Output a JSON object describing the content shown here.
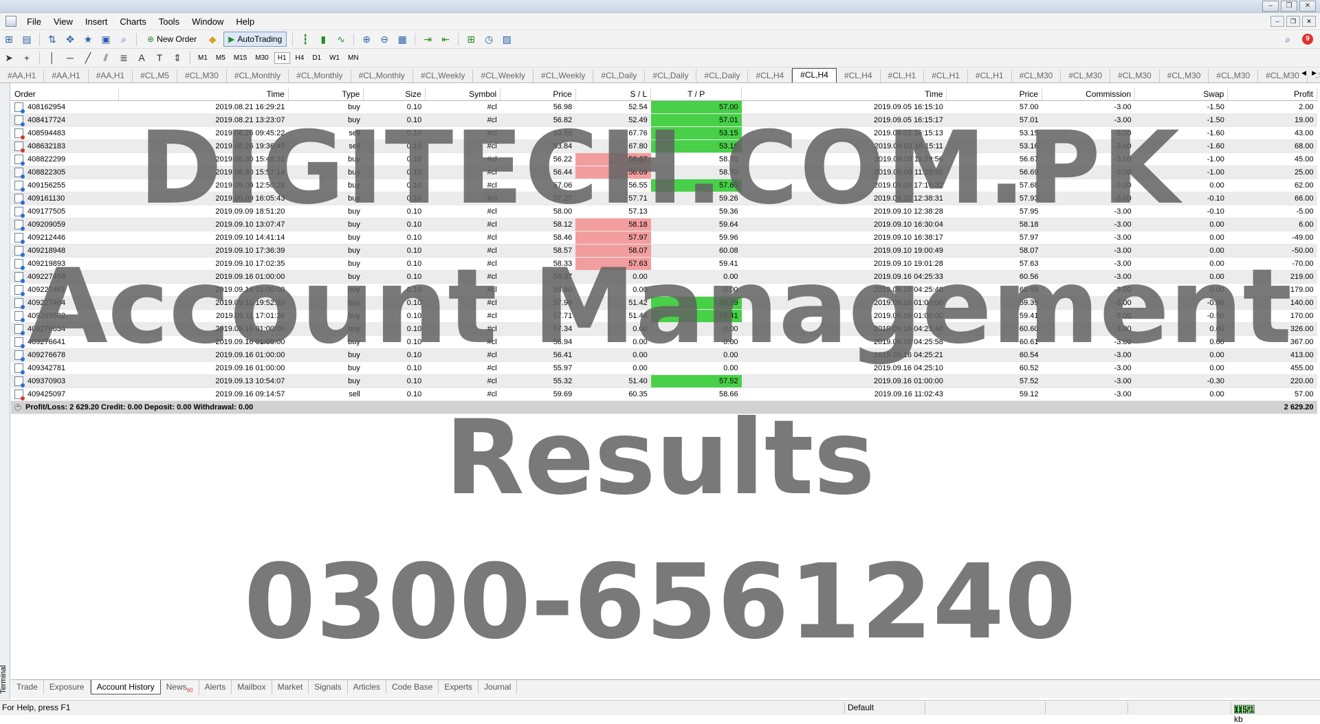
{
  "menu": {
    "items": [
      "File",
      "View",
      "Insert",
      "Charts",
      "Tools",
      "Window",
      "Help"
    ]
  },
  "toolbar": {
    "new_order": "New Order",
    "autotrading": "AutoTrading",
    "timeframes": [
      "M1",
      "M5",
      "M15",
      "M30",
      "H1",
      "H4",
      "D1",
      "W1",
      "MN"
    ],
    "active_timeframe": "H1",
    "notification_count": "9"
  },
  "chart_tabs": [
    "#AA,H1",
    "#AA,H1",
    "#AA,H1",
    "#CL,M5",
    "#CL,M30",
    "#CL,Monthly",
    "#CL,Monthly",
    "#CL,Monthly",
    "#CL,Weekly",
    "#CL,Weekly",
    "#CL,Weekly",
    "#CL,Daily",
    "#CL,Daily",
    "#CL,Daily",
    "#CL,H4",
    "#CL,H4",
    "#CL,H4",
    "#CL,H1",
    "#CL,H1",
    "#CL,H1",
    "#CL,M30",
    "#CL,M30",
    "#CL,M30",
    "#CL,M30",
    "#CL,M30",
    "#CL,M30",
    "#CL,M"
  ],
  "active_chart_tab": 15,
  "columns": [
    "Order",
    "Time",
    "Type",
    "Size",
    "Symbol",
    "Price",
    "S / L",
    "T / P",
    "Time",
    "Price",
    "Commission",
    "Swap",
    "Profit"
  ],
  "rows": [
    {
      "order": "408162954",
      "open_time": "2019.08.21 16:29:21",
      "type": "buy",
      "size": "0.10",
      "symbol": "#cl",
      "price": "56.98",
      "sl": "52.54",
      "tp": "57.00",
      "close_time": "2019.09.05 16:15:10",
      "close_price": "57.00",
      "commission": "-3.00",
      "swap": "-1.50",
      "profit": "2.00",
      "hit": "tp"
    },
    {
      "order": "408417724",
      "open_time": "2019.08.21 13:23:07",
      "type": "buy",
      "size": "0.10",
      "symbol": "#cl",
      "price": "56.82",
      "sl": "52.49",
      "tp": "57.01",
      "close_time": "2019.09.05 16:15:17",
      "close_price": "57.01",
      "commission": "-3.00",
      "swap": "-1.50",
      "profit": "19.00",
      "hit": "tp"
    },
    {
      "order": "408594483",
      "open_time": "2019.08.26 09:45:22",
      "type": "sell",
      "size": "0.10",
      "symbol": "#cl",
      "price": "53.58",
      "sl": "67.76",
      "tp": "53.15",
      "close_time": "2019.09.03 16:15:13",
      "close_price": "53.15",
      "commission": "-3.00",
      "swap": "-1.60",
      "profit": "43.00",
      "hit": "tp"
    },
    {
      "order": "408632183",
      "open_time": "2019.08.26 19:36:45",
      "type": "sell",
      "size": "0.10",
      "symbol": "#cl",
      "price": "53.84",
      "sl": "67.80",
      "tp": "53.16",
      "close_time": "2019.09.03 16:15:11",
      "close_price": "53.16",
      "commission": "-3.00",
      "swap": "-1.60",
      "profit": "68.00",
      "hit": "tp"
    },
    {
      "order": "408822299",
      "open_time": "2019.08.30 15:48:32",
      "type": "buy",
      "size": "0.10",
      "symbol": "#cl",
      "price": "56.22",
      "sl": "56.67",
      "tp": "58.70",
      "close_time": "2019.09.09 11:29:56",
      "close_price": "56.67",
      "commission": "-3.00",
      "swap": "-1.00",
      "profit": "45.00",
      "hit": "sl"
    },
    {
      "order": "408822305",
      "open_time": "2019.08.30 15:57:14",
      "type": "buy",
      "size": "0.10",
      "symbol": "#cl",
      "price": "56.44",
      "sl": "56.69",
      "tp": "58.70",
      "close_time": "2019.09.09 11:29:55",
      "close_price": "56.69",
      "commission": "-3.00",
      "swap": "-1.00",
      "profit": "25.00",
      "hit": "sl"
    },
    {
      "order": "409156255",
      "open_time": "2019.09.09 12:50:28",
      "type": "buy",
      "size": "0.10",
      "symbol": "#cl",
      "price": "57.06",
      "sl": "56.55",
      "tp": "57.68",
      "close_time": "2019.09.09 17:16:32",
      "close_price": "57.68",
      "commission": "-3.00",
      "swap": "0.00",
      "profit": "62.00",
      "hit": "tp"
    },
    {
      "order": "409161130",
      "open_time": "2019.09.09 16:05:43",
      "type": "buy",
      "size": "0.10",
      "symbol": "#cl",
      "price": "57.27",
      "sl": "57.71",
      "tp": "59.26",
      "close_time": "2019.09.10 12:38:31",
      "close_price": "57.93",
      "commission": "-3.00",
      "swap": "-0.10",
      "profit": "66.00",
      "hit": ""
    },
    {
      "order": "409177505",
      "open_time": "2019.09.09 18:51:20",
      "type": "buy",
      "size": "0.10",
      "symbol": "#cl",
      "price": "58.00",
      "sl": "57.13",
      "tp": "59.36",
      "close_time": "2019.09.10 12:38:28",
      "close_price": "57.95",
      "commission": "-3.00",
      "swap": "-0.10",
      "profit": "-5.00",
      "hit": ""
    },
    {
      "order": "409209059",
      "open_time": "2019.09.10 13:07:47",
      "type": "buy",
      "size": "0.10",
      "symbol": "#cl",
      "price": "58.12",
      "sl": "58.18",
      "tp": "59.64",
      "close_time": "2019.09.10 16:30:04",
      "close_price": "58.18",
      "commission": "-3.00",
      "swap": "0.00",
      "profit": "6.00",
      "hit": "sl"
    },
    {
      "order": "409212446",
      "open_time": "2019.09.10 14:41:14",
      "type": "buy",
      "size": "0.10",
      "symbol": "#cl",
      "price": "58.46",
      "sl": "57.97",
      "tp": "59.96",
      "close_time": "2019.09.10 16:38:17",
      "close_price": "57.97",
      "commission": "-3.00",
      "swap": "0.00",
      "profit": "-49.00",
      "hit": "sl"
    },
    {
      "order": "409218948",
      "open_time": "2019.09.10 17:36:39",
      "type": "buy",
      "size": "0.10",
      "symbol": "#cl",
      "price": "58.57",
      "sl": "58.07",
      "tp": "60.08",
      "close_time": "2019.09.10 19:00:49",
      "close_price": "58.07",
      "commission": "-3.00",
      "swap": "0.00",
      "profit": "-50.00",
      "hit": "sl"
    },
    {
      "order": "409219893",
      "open_time": "2019.09.10 17:02:35",
      "type": "buy",
      "size": "0.10",
      "symbol": "#cl",
      "price": "58.33",
      "sl": "57.63",
      "tp": "59.41",
      "close_time": "2019.09.10 19:01:28",
      "close_price": "57.63",
      "commission": "-3.00",
      "swap": "0.00",
      "profit": "-70.00",
      "hit": "sl"
    },
    {
      "order": "409227458",
      "open_time": "2019.09.16 01:00:00",
      "type": "buy",
      "size": "0.10",
      "symbol": "#cl",
      "price": "58.37",
      "sl": "0.00",
      "tp": "0.00",
      "close_time": "2019.09.16 04:25:33",
      "close_price": "60.56",
      "commission": "-3.00",
      "swap": "0.00",
      "profit": "219.00",
      "hit": ""
    },
    {
      "order": "409227461",
      "open_time": "2019.09.16 01:00:00",
      "type": "buy",
      "size": "0.10",
      "symbol": "#cl",
      "price": "58.80",
      "sl": "0.00",
      "tp": "0.00",
      "close_time": "2019.09.16 04:25:40",
      "close_price": "60.59",
      "commission": "-3.00",
      "swap": "0.00",
      "profit": "179.00",
      "hit": ""
    },
    {
      "order": "409227464",
      "open_time": "2019.09.10 19:52:33",
      "type": "buy",
      "size": "0.10",
      "symbol": "#cl",
      "price": "57.99",
      "sl": "51.42",
      "tp": "59.39",
      "close_time": "2019.09.16 01:00:00",
      "close_price": "59.39",
      "commission": "-3.00",
      "swap": "-0.60",
      "profit": "140.00",
      "hit": "tp"
    },
    {
      "order": "409269502",
      "open_time": "2019.09.11 17:01:36",
      "type": "buy",
      "size": "0.10",
      "symbol": "#cl",
      "price": "57.71",
      "sl": "51.44",
      "tp": "59.41",
      "close_time": "2019.09.16 01:00:00",
      "close_price": "59.41",
      "commission": "-3.00",
      "swap": "-0.50",
      "profit": "170.00",
      "hit": "tp"
    },
    {
      "order": "409276634",
      "open_time": "2019.09.16 01:00:00",
      "type": "buy",
      "size": "0.10",
      "symbol": "#cl",
      "price": "57.34",
      "sl": "0.00",
      "tp": "0.00",
      "close_time": "2019.09.16 04:25:48",
      "close_price": "60.60",
      "commission": "-3.00",
      "swap": "0.00",
      "profit": "326.00",
      "hit": ""
    },
    {
      "order": "409276641",
      "open_time": "2019.09.16 01:00:00",
      "type": "buy",
      "size": "0.10",
      "symbol": "#cl",
      "price": "56.94",
      "sl": "0.00",
      "tp": "0.00",
      "close_time": "2019.09.16 04:25:58",
      "close_price": "60.61",
      "commission": "-3.00",
      "swap": "0.00",
      "profit": "367.00",
      "hit": ""
    },
    {
      "order": "409276678",
      "open_time": "2019.09.16 01:00:00",
      "type": "buy",
      "size": "0.10",
      "symbol": "#cl",
      "price": "56.41",
      "sl": "0.00",
      "tp": "0.00",
      "close_time": "2019.09.16 04:25:21",
      "close_price": "60.54",
      "commission": "-3.00",
      "swap": "0.00",
      "profit": "413.00",
      "hit": ""
    },
    {
      "order": "409342781",
      "open_time": "2019.09.16 01:00:00",
      "type": "buy",
      "size": "0.10",
      "symbol": "#cl",
      "price": "55.97",
      "sl": "0.00",
      "tp": "0.00",
      "close_time": "2019.09.16 04:25:10",
      "close_price": "60.52",
      "commission": "-3.00",
      "swap": "0.00",
      "profit": "455.00",
      "hit": ""
    },
    {
      "order": "409370903",
      "open_time": "2019.09.13 10:54:07",
      "type": "buy",
      "size": "0.10",
      "symbol": "#cl",
      "price": "55.32",
      "sl": "51.40",
      "tp": "57.52",
      "close_time": "2019.09.16 01:00:00",
      "close_price": "57.52",
      "commission": "-3.00",
      "swap": "-0.30",
      "profit": "220.00",
      "hit": "tp"
    },
    {
      "order": "409425097",
      "open_time": "2019.09.16 09:14:57",
      "type": "sell",
      "size": "0.10",
      "symbol": "#cl",
      "price": "59.69",
      "sl": "60.35",
      "tp": "58.66",
      "close_time": "2019.09.16 11:02:43",
      "close_price": "59.12",
      "commission": "-3.00",
      "swap": "0.00",
      "profit": "57.00",
      "hit": ""
    }
  ],
  "summary": {
    "text": "Profit/Loss: 2 629.20  Credit: 0.00  Deposit: 0.00  Withdrawal: 0.00",
    "total": "2 629.20"
  },
  "terminal_label": "Terminal",
  "bottom_tabs": [
    {
      "label": "Trade"
    },
    {
      "label": "Exposure"
    },
    {
      "label": "Account History",
      "active": true
    },
    {
      "label": "News",
      "badge": "60"
    },
    {
      "label": "Alerts"
    },
    {
      "label": "Mailbox"
    },
    {
      "label": "Market"
    },
    {
      "label": "Signals"
    },
    {
      "label": "Articles"
    },
    {
      "label": "Code Base"
    },
    {
      "label": "Experts"
    },
    {
      "label": "Journal"
    }
  ],
  "status": {
    "help": "For Help, press F1",
    "profile": "Default",
    "traffic": "115/1 kb"
  },
  "watermark": {
    "line1": "DIGITECH.COM.PK",
    "line2": "Account Management",
    "line3": "Results",
    "line4": "0300-6561240"
  },
  "colors": {
    "tp_hit": "#48d048",
    "sl_hit": "#f29e9e",
    "alt_row": "#ececec"
  }
}
